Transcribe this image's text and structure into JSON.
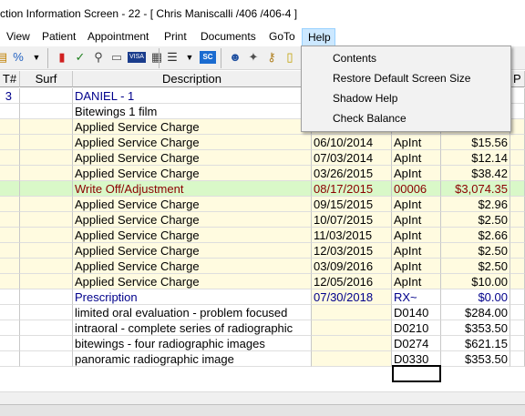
{
  "window": {
    "title": "ction Information Screen - 22 - [ Chris Maniscalli /406 /406-4 ]"
  },
  "menubar": [
    "View",
    "Patient",
    "Appointment",
    "Print",
    "Documents",
    "GoTo",
    "Help"
  ],
  "help_menu": [
    "Contents",
    "Restore Default Screen Size",
    "Shadow Help",
    "Check Balance"
  ],
  "toolbar_icons": [
    "tooth-icon",
    "tooth-percent-icon",
    "dropdown-arrow-icon",
    "red-flag-icon",
    "checkmark-pencil-icon",
    "microscope-icon",
    "card-icon",
    "visa-card-icon",
    "calculator-icon",
    "notes-icon",
    "dropdown-arrow-icon",
    "sc-icon",
    "people-icon",
    "tooth-xray-icon",
    "key-icon",
    "note-icon"
  ],
  "grid": {
    "columns": [
      "T#",
      "Surf",
      "Description",
      "",
      "",
      "",
      "P"
    ],
    "rows": [
      {
        "tooth": "3",
        "surf": "",
        "desc": "DANIEL - 1",
        "date": "",
        "code": "",
        "amount": "",
        "bg": "#ffffff",
        "color": "#00008b"
      },
      {
        "tooth": "",
        "surf": "",
        "desc": "Bitewings 1 film",
        "date": "",
        "code": "",
        "amount": "",
        "bg": "#ffffff",
        "color": "#000000"
      },
      {
        "tooth": "",
        "surf": "",
        "desc": "Applied Service Charge",
        "date": "",
        "code": "",
        "amount": "",
        "bg": "#fffbe0",
        "color": "#000000"
      },
      {
        "tooth": "",
        "surf": "",
        "desc": "Applied Service Charge",
        "date": "06/10/2014",
        "code": "ApInt",
        "amount": "$15.56",
        "bg": "#fffbe0",
        "color": "#000000"
      },
      {
        "tooth": "",
        "surf": "",
        "desc": "Applied Service Charge",
        "date": "07/03/2014",
        "code": "ApInt",
        "amount": "$12.14",
        "bg": "#fffbe0",
        "color": "#000000"
      },
      {
        "tooth": "",
        "surf": "",
        "desc": "Applied Service Charge",
        "date": "03/26/2015",
        "code": "ApInt",
        "amount": "$38.42",
        "bg": "#fffbe0",
        "color": "#000000"
      },
      {
        "tooth": "",
        "surf": "",
        "desc": "Write Off/Adjustment",
        "date": "08/17/2015",
        "code": "00006",
        "amount": "$3,074.35",
        "bg": "#d9f8c8",
        "color": "#8b0000"
      },
      {
        "tooth": "",
        "surf": "",
        "desc": "Applied Service Charge",
        "date": "09/15/2015",
        "code": "ApInt",
        "amount": "$2.96",
        "bg": "#fffbe0",
        "color": "#000000"
      },
      {
        "tooth": "",
        "surf": "",
        "desc": "Applied Service Charge",
        "date": "10/07/2015",
        "code": "ApInt",
        "amount": "$2.50",
        "bg": "#fffbe0",
        "color": "#000000"
      },
      {
        "tooth": "",
        "surf": "",
        "desc": "Applied Service Charge",
        "date": "11/03/2015",
        "code": "ApInt",
        "amount": "$2.66",
        "bg": "#fffbe0",
        "color": "#000000"
      },
      {
        "tooth": "",
        "surf": "",
        "desc": "Applied Service Charge",
        "date": "12/03/2015",
        "code": "ApInt",
        "amount": "$2.50",
        "bg": "#fffbe0",
        "color": "#000000"
      },
      {
        "tooth": "",
        "surf": "",
        "desc": "Applied Service Charge",
        "date": "03/09/2016",
        "code": "ApInt",
        "amount": "$2.50",
        "bg": "#fffbe0",
        "color": "#000000"
      },
      {
        "tooth": "",
        "surf": "",
        "desc": "Applied Service Charge",
        "date": "12/05/2016",
        "code": "ApInt",
        "amount": "$10.00",
        "bg": "#fffbe0",
        "color": "#000000"
      },
      {
        "tooth": "",
        "surf": "",
        "desc": "Prescription",
        "date": "07/30/2018",
        "code": "RX~",
        "amount": "$0.00",
        "bg": "#ffffff",
        "color": "#00008b"
      },
      {
        "tooth": "",
        "surf": "",
        "desc": "limited oral evaluation - problem focused",
        "date": "",
        "code": "D0140",
        "amount": "$284.00",
        "bg": "#ffffff",
        "color": "#000000"
      },
      {
        "tooth": "",
        "surf": "",
        "desc": "intraoral - complete series of radiographic",
        "date": "",
        "code": "D0210",
        "amount": "$353.50",
        "bg": "#ffffff",
        "color": "#000000"
      },
      {
        "tooth": "",
        "surf": "",
        "desc": "bitewings - four radiographic images",
        "date": "",
        "code": "D0274",
        "amount": "$621.15",
        "bg": "#ffffff",
        "color": "#000000"
      },
      {
        "tooth": "",
        "surf": "",
        "desc": "panoramic radiographic image",
        "date": "",
        "code": "D0330",
        "amount": "$353.50",
        "bg": "#ffffff",
        "color": "#000000"
      }
    ]
  },
  "colors": {
    "date_col_bg": "#fffbe0",
    "menu_active_bg": "#cce8ff",
    "dropdown_bg": "#f2f2f2"
  }
}
